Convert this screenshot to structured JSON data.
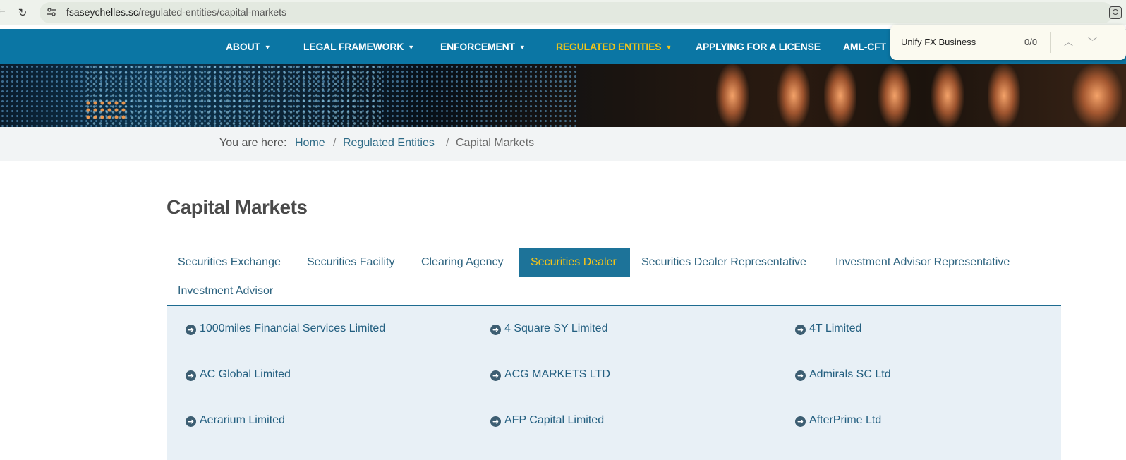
{
  "browser": {
    "url_host": "fsaseychelles.sc",
    "url_path": "/regulated-entities/capital-markets"
  },
  "nav": {
    "items": [
      {
        "label": "ABOUT",
        "dropdown": true
      },
      {
        "label": "LEGAL FRAMEWORK",
        "dropdown": true
      },
      {
        "label": "ENFORCEMENT",
        "dropdown": true
      },
      {
        "label": "REGULATED ENTITIES",
        "dropdown": true,
        "active": true
      },
      {
        "label": "APPLYING FOR A LICENSE",
        "dropdown": false
      },
      {
        "label": "AML-CFT",
        "dropdown": false
      }
    ],
    "background": "#0b76a4",
    "active_color": "#f0c419"
  },
  "findbar": {
    "query": "Unify FX Business",
    "count": "0/0"
  },
  "breadcrumb": {
    "label": "You are here:",
    "items": [
      "Home",
      "Regulated Entities",
      "Capital Markets"
    ],
    "separator": "/"
  },
  "page_title": "Capital Markets",
  "tabs": [
    {
      "label": "Securities Exchange"
    },
    {
      "label": "Securities Facility"
    },
    {
      "label": "Clearing Agency"
    },
    {
      "label": "Securities Dealer",
      "active": true
    },
    {
      "label": "Securities Dealer Representative"
    },
    {
      "label": "Investment Advisor Representative"
    },
    {
      "label": "Investment Advisor"
    }
  ],
  "entities": [
    "1000miles Financial Services Limited",
    "4 Square SY Limited",
    "4T Limited",
    "AC Global Limited",
    "ACG MARKETS LTD",
    "Admirals SC Ltd",
    "Aerarium Limited",
    "AFP Capital Limited",
    "AfterPrime Ltd"
  ],
  "icons": {
    "reload": "reload-icon",
    "site_settings": "site-settings-icon",
    "extension": "extension-icon",
    "entity_link": "arrow-circle-right-icon"
  }
}
